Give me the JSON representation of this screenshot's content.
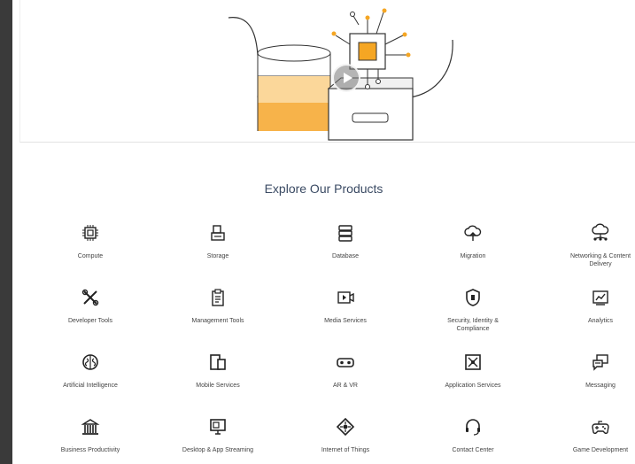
{
  "section": {
    "title": "Explore Our Products"
  },
  "products": [
    {
      "label": "Compute",
      "icon": "chip-icon"
    },
    {
      "label": "Storage",
      "icon": "storage-icon"
    },
    {
      "label": "Database",
      "icon": "database-icon"
    },
    {
      "label": "Migration",
      "icon": "cloud-upload-icon"
    },
    {
      "label": "Networking & Content Delivery",
      "icon": "network-cloud-icon"
    },
    {
      "label": "Developer Tools",
      "icon": "tools-icon"
    },
    {
      "label": "Management Tools",
      "icon": "clipboard-icon"
    },
    {
      "label": "Media Services",
      "icon": "video-icon"
    },
    {
      "label": "Security, Identity & Compliance",
      "icon": "shield-icon"
    },
    {
      "label": "Analytics",
      "icon": "chart-icon"
    },
    {
      "label": "Artificial Intelligence",
      "icon": "brain-icon"
    },
    {
      "label": "Mobile Services",
      "icon": "mobile-icon"
    },
    {
      "label": "AR & VR",
      "icon": "vr-goggles-icon"
    },
    {
      "label": "Application Services",
      "icon": "app-services-icon"
    },
    {
      "label": "Messaging",
      "icon": "message-icon"
    },
    {
      "label": "Business Productivity",
      "icon": "building-icon"
    },
    {
      "label": "Desktop & App Streaming",
      "icon": "desktop-stream-icon"
    },
    {
      "label": "Internet of Things",
      "icon": "iot-icon"
    },
    {
      "label": "Contact Center",
      "icon": "headset-icon"
    },
    {
      "label": "Game Development",
      "icon": "gamepad-icon"
    }
  ],
  "colors": {
    "accent": "#f5a623",
    "title": "#3a4a63"
  }
}
